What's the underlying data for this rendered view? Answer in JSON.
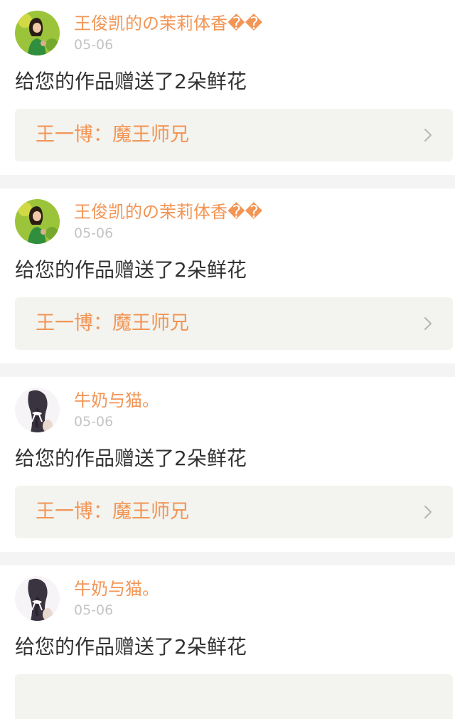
{
  "colors": {
    "accent": "#f29555",
    "muted": "#c4c4c4",
    "text": "#333333",
    "link_bg": "#f3f3ef",
    "page_bg": "#f4f4f4"
  },
  "notifications": [
    {
      "user": "王俊凯的の茉莉体香��",
      "time": "05-06",
      "message": "给您的作品赠送了2朵鲜花",
      "work_title": "王一博：魔王师兄",
      "avatar_icon": "woman-green-avatar",
      "link_icon": "chevron-right-icon"
    },
    {
      "user": "王俊凯的の茉莉体香��",
      "time": "05-06",
      "message": "给您的作品赠送了2朵鲜花",
      "work_title": "王一博：魔王师兄",
      "avatar_icon": "woman-green-avatar",
      "link_icon": "chevron-right-icon"
    },
    {
      "user": "牛奶与猫。",
      "time": "05-06",
      "message": "给您的作品赠送了2朵鲜花",
      "work_title": "王一博：魔王师兄",
      "avatar_icon": "braided-hair-avatar",
      "link_icon": "chevron-right-icon"
    },
    {
      "user": "牛奶与猫。",
      "time": "05-06",
      "message": "给您的作品赠送了2朵鲜花",
      "work_title": "",
      "avatar_icon": "braided-hair-avatar",
      "link_icon": "chevron-right-icon"
    }
  ]
}
